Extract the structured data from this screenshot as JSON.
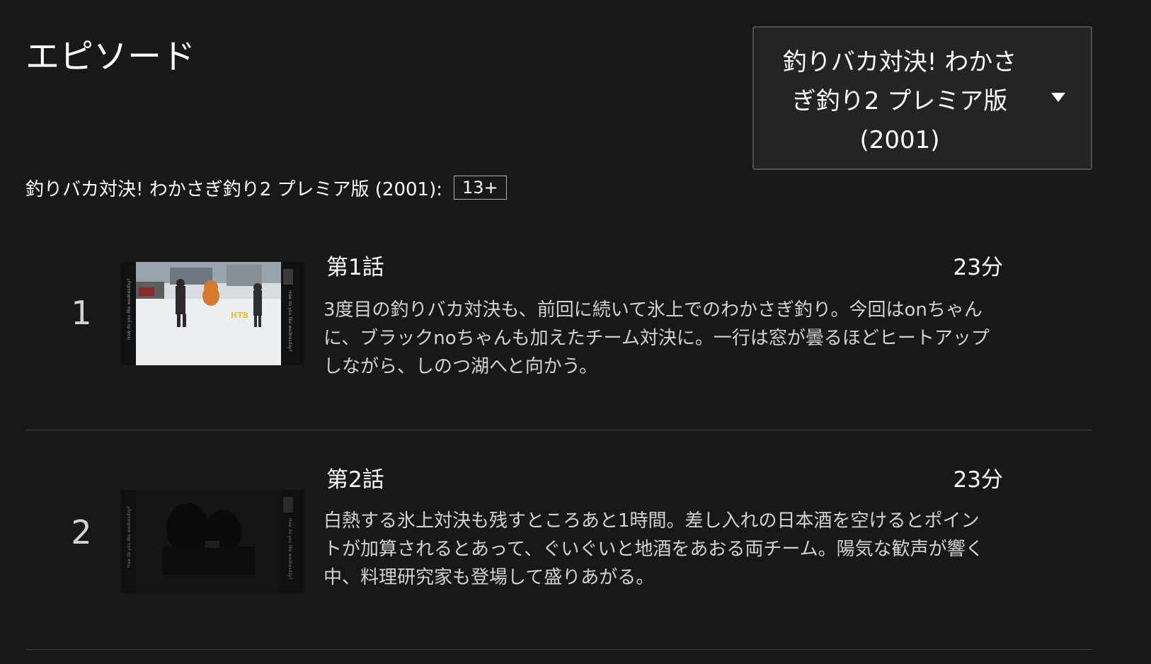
{
  "page": {
    "title": "エピソード"
  },
  "season_selector": {
    "selected": "釣りバカ対決! わかさぎ釣り2 プレミア版 (2001)",
    "icon": "caret-down-icon"
  },
  "show": {
    "title": "釣りバカ対決! わかさぎ釣り2 プレミア版 (2001):",
    "rating": "13+"
  },
  "episodes": [
    {
      "index": "1",
      "title": "第1話",
      "duration": "23分",
      "synopsis": "3度目の釣りバカ対決も、前回に続いて氷上でのわかさぎ釣り。今回はonちゃんに、ブラックnoちゃんも加えたチーム対決に。一行は窓が曇るほどヒートアップしながら、しのつ湖へと向かう。",
      "thumbnail_overlay": "HTB",
      "thumbnail_side_text": "How do you like wednesday?"
    },
    {
      "index": "2",
      "title": "第2話",
      "duration": "23分",
      "synopsis": "白熱する氷上対決も残すところあと1時間。差し入れの日本酒を空けるとポイントが加算されるとあって、ぐいぐいと地酒をあおる両チーム。陽気な歓声が響く中、料理研究家も登場して盛りあがる。",
      "thumbnail_side_text": "How do you like wednesday?"
    }
  ]
}
